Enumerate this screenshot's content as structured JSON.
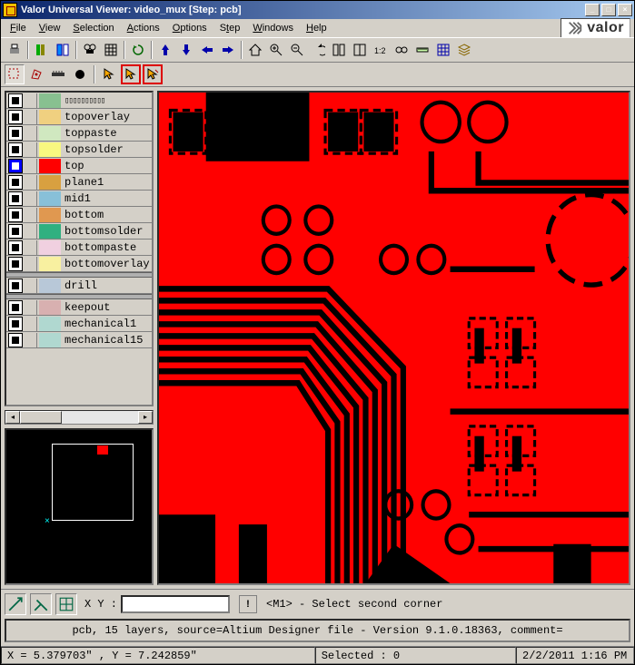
{
  "window": {
    "title": "Valor Universal Viewer: video_mux [Step: pcb]"
  },
  "brand": {
    "text": "valor"
  },
  "menu": [
    "File",
    "View",
    "Selection",
    "Actions",
    "Options",
    "Step",
    "Windows",
    "Help"
  ],
  "toolbar1": [
    {
      "name": "print-icon"
    },
    {
      "sep": true
    },
    {
      "name": "layers-icon"
    },
    {
      "name": "layerpair-icon"
    },
    {
      "sep": true
    },
    {
      "name": "find-icon"
    },
    {
      "name": "grid-icon"
    },
    {
      "sep": true
    },
    {
      "name": "refresh-icon"
    },
    {
      "sep": true
    },
    {
      "name": "arrow-up-icon"
    },
    {
      "name": "arrow-down-icon"
    },
    {
      "name": "arrow-left-icon"
    },
    {
      "name": "arrow-right-icon"
    },
    {
      "sep": true
    },
    {
      "name": "home-icon"
    },
    {
      "name": "zoom-in-icon"
    },
    {
      "name": "zoom-out-icon"
    },
    {
      "name": "undo-icon"
    },
    {
      "name": "compare-icon"
    },
    {
      "name": "split-icon"
    },
    {
      "name": "ratio-icon"
    },
    {
      "name": "binoculars-icon"
    },
    {
      "name": "ruler-icon"
    },
    {
      "name": "grid2-icon"
    },
    {
      "name": "layers2-icon"
    }
  ],
  "toolbar2": [
    {
      "name": "select-rect-icon",
      "pressed": true
    },
    {
      "name": "select-poly-icon"
    },
    {
      "name": "measure-icon"
    },
    {
      "name": "circle-fill-icon"
    },
    {
      "sep": true
    },
    {
      "name": "pointer-icon"
    },
    {
      "name": "pointer-a-icon",
      "red": true
    },
    {
      "name": "pointer-b-icon",
      "red": true
    }
  ],
  "layers": [
    {
      "group": "signal",
      "items": [
        {
          "name": "",
          "color": "#88c090",
          "vis": "on",
          "icon": "comp"
        },
        {
          "name": "topoverlay",
          "color": "#f0d080",
          "vis": "on"
        },
        {
          "name": "toppaste",
          "color": "#d0e8c0",
          "vis": "on"
        },
        {
          "name": "topsolder",
          "color": "#f8f880",
          "vis": "on"
        },
        {
          "name": "top",
          "color": "#ff0000",
          "vis": "sel"
        },
        {
          "name": "plane1",
          "color": "#d8a040",
          "vis": "on"
        },
        {
          "name": "mid1",
          "color": "#88c0d8",
          "vis": "on"
        },
        {
          "name": "bottom",
          "color": "#e09850",
          "vis": "on"
        },
        {
          "name": "bottomsolder",
          "color": "#30b080",
          "vis": "on"
        },
        {
          "name": "bottompaste",
          "color": "#f0d0e0",
          "vis": "on"
        },
        {
          "name": "bottomoverlay",
          "color": "#f8f0a0",
          "vis": "on"
        }
      ]
    },
    {
      "group": "drill",
      "items": [
        {
          "name": "drill",
          "color": "#b8c8d8",
          "vis": "on"
        }
      ]
    },
    {
      "group": "misc",
      "items": [
        {
          "name": "keepout",
          "color": "#d8b0b0",
          "vis": "on"
        },
        {
          "name": "mechanical1",
          "color": "#b0d8d0",
          "vis": "on"
        },
        {
          "name": "mechanical15",
          "color": "#b0d8d0",
          "vis": "on"
        }
      ]
    }
  ],
  "bottom": {
    "xy_label": "X Y :",
    "xy_value": "",
    "warn": "!",
    "prompt": "<M1> - Select second corner"
  },
  "info": "pcb, 15 layers, source=Altium Designer file - Version 9.1.0.18363, comment=",
  "status": {
    "coords": "X = 5.379703\" , Y = 7.242859\"",
    "selected": "Selected : 0",
    "datetime": "2/2/2011  1:16 PM"
  }
}
